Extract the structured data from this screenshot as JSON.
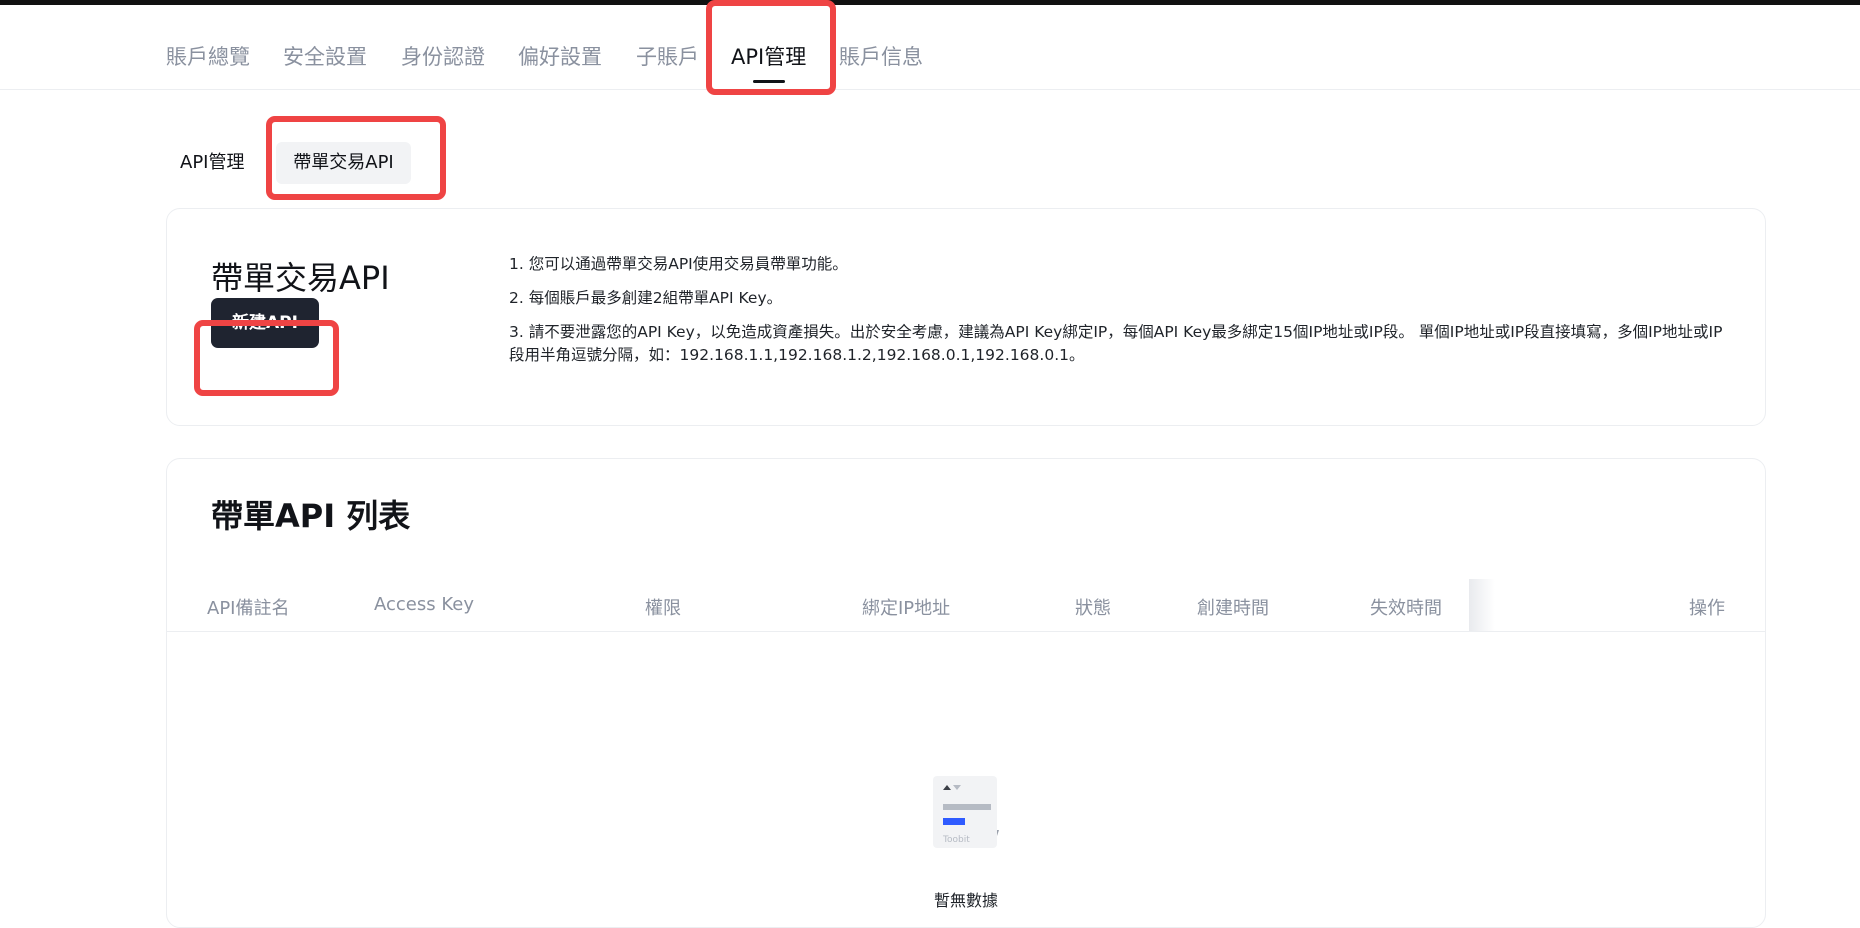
{
  "top_nav": {
    "tabs": [
      {
        "label": "賬戶總覽"
      },
      {
        "label": "安全設置"
      },
      {
        "label": "身份認證"
      },
      {
        "label": "偏好設置"
      },
      {
        "label": "子賬戶"
      },
      {
        "label": "API管理"
      },
      {
        "label": "賬戶信息"
      }
    ],
    "active": "API管理"
  },
  "sub_tabs": {
    "items": [
      {
        "label": "API管理"
      },
      {
        "label": "帶單交易API"
      }
    ],
    "active": "帶單交易API"
  },
  "intro_card": {
    "title": "帶單交易API",
    "new_button_label": "新建API",
    "tips": [
      "1. 您可以通過帶單交易API使用交易員帶單功能。",
      "2. 每個賬戶最多創建2組帶單API Key。",
      "3. 請不要泄露您的API Key，以免造成資產損失。出於安全考慮，建議為API Key綁定IP，每個API Key最多綁定15個IP地址或IP段。 單個IP地址或IP段直接填寫，多個IP地址或IP段用半角逗號分隔，如：192.168.1.1,192.168.1.2,192.168.0.1,192.168.0.1。"
    ]
  },
  "list_card": {
    "title": "帶單API 列表",
    "columns": [
      "API備註名",
      "Access Key",
      "權限",
      "綁定IP地址",
      "狀態",
      "創建時間",
      "失效時間",
      "操作"
    ],
    "rows": [],
    "empty_text": "暫無數據",
    "empty_icon_caption": "Toobit"
  },
  "colors": {
    "highlight": "#ef4444",
    "primary_button": "#1f2430",
    "muted_text": "#8a919f",
    "accent_blue": "#2f5bff"
  }
}
